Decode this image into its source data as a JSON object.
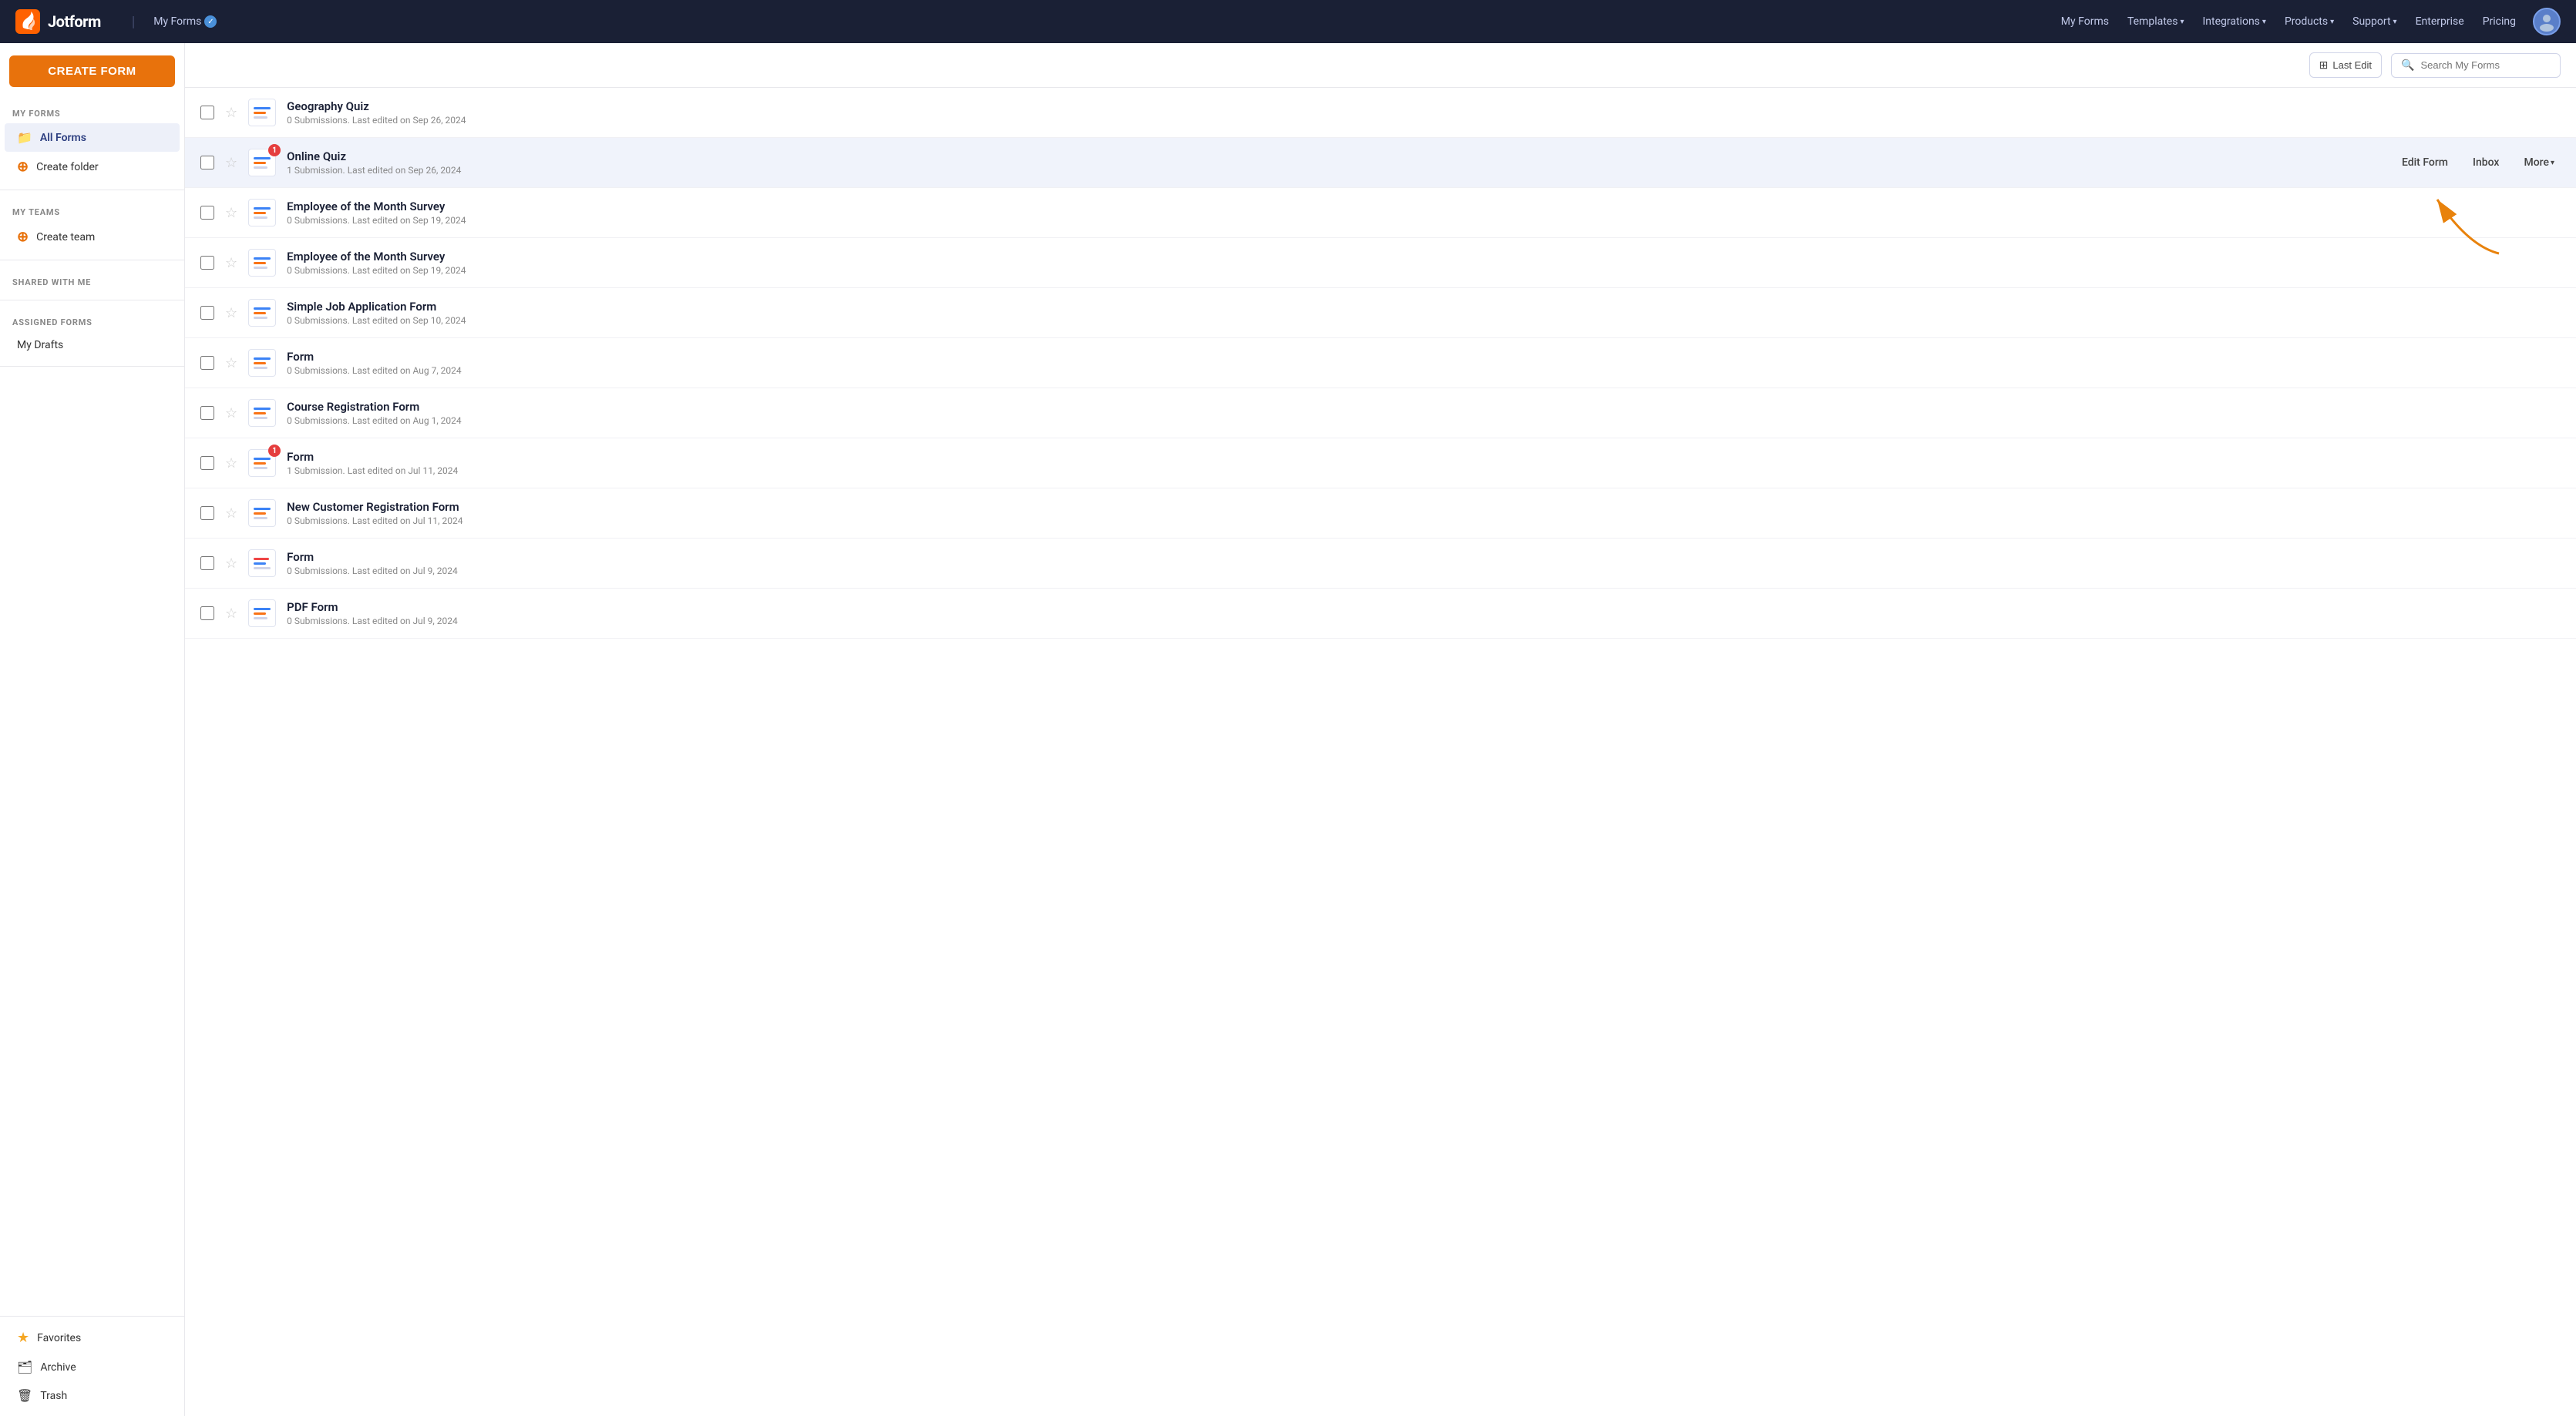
{
  "app": {
    "name": "Jotform",
    "tagline": "My Forms"
  },
  "topnav": {
    "brand": "Jotform",
    "context_label": "My Forms",
    "links": [
      {
        "label": "My Forms",
        "has_dropdown": false
      },
      {
        "label": "Templates",
        "has_dropdown": true
      },
      {
        "label": "Integrations",
        "has_dropdown": true
      },
      {
        "label": "Products",
        "has_dropdown": true
      },
      {
        "label": "Support",
        "has_dropdown": true
      },
      {
        "label": "Enterprise",
        "has_dropdown": false
      },
      {
        "label": "Pricing",
        "has_dropdown": false
      }
    ]
  },
  "sidebar": {
    "create_form_label": "CREATE FORM",
    "my_forms_section": "MY FORMS",
    "all_forms_label": "All Forms",
    "create_folder_label": "Create folder",
    "my_teams_section": "MY TEAMS",
    "create_team_label": "Create team",
    "shared_section": "SHARED WITH ME",
    "assigned_section": "ASSIGNED FORMS",
    "my_drafts_label": "My Drafts",
    "favorites_label": "Favorites",
    "archive_label": "Archive",
    "trash_label": "Trash"
  },
  "toolbar": {
    "last_edit_label": "Last Edit",
    "search_placeholder": "Search My Forms"
  },
  "forms": [
    {
      "title": "Geography Quiz",
      "meta": "0 Submissions. Last edited on Sep 26, 2024",
      "badge": null,
      "starred": false
    },
    {
      "title": "Online Quiz",
      "meta": "1 Submission. Last edited on Sep 26, 2024",
      "badge": "1",
      "starred": false,
      "highlighted": true
    },
    {
      "title": "Employee of the Month Survey",
      "meta": "0 Submissions. Last edited on Sep 19, 2024",
      "badge": null,
      "starred": false
    },
    {
      "title": "Employee of the Month Survey",
      "meta": "0 Submissions. Last edited on Sep 19, 2024",
      "badge": null,
      "starred": false
    },
    {
      "title": "Simple Job Application Form",
      "meta": "0 Submissions. Last edited on Sep 10, 2024",
      "badge": null,
      "starred": false
    },
    {
      "title": "Form",
      "meta": "0 Submissions. Last edited on Aug 7, 2024",
      "badge": null,
      "starred": false
    },
    {
      "title": "Course Registration Form",
      "meta": "0 Submissions. Last edited on Aug 1, 2024",
      "badge": null,
      "starred": false
    },
    {
      "title": "Form",
      "meta": "1 Submission. Last edited on Jul 11, 2024",
      "badge": "1",
      "starred": false
    },
    {
      "title": "New Customer Registration Form",
      "meta": "0 Submissions. Last edited on Jul 11, 2024",
      "badge": null,
      "starred": false
    },
    {
      "title": "Form",
      "meta": "0 Submissions. Last edited on Jul 9, 2024",
      "badge": null,
      "starred": false,
      "pdf": true
    },
    {
      "title": "PDF Form",
      "meta": "0 Submissions. Last edited on Jul 9, 2024",
      "badge": null,
      "starred": false
    }
  ],
  "row_actions": {
    "edit_form": "Edit Form",
    "inbox": "Inbox",
    "more": "More"
  },
  "icons": {
    "star_empty": "☆",
    "star_filled": "★",
    "folder": "📁",
    "plus": "+",
    "people": "👥",
    "search": "🔍",
    "filter": "⊞",
    "favorites_star": "★",
    "archive_box": "📦",
    "trash_bin": "🗑"
  }
}
